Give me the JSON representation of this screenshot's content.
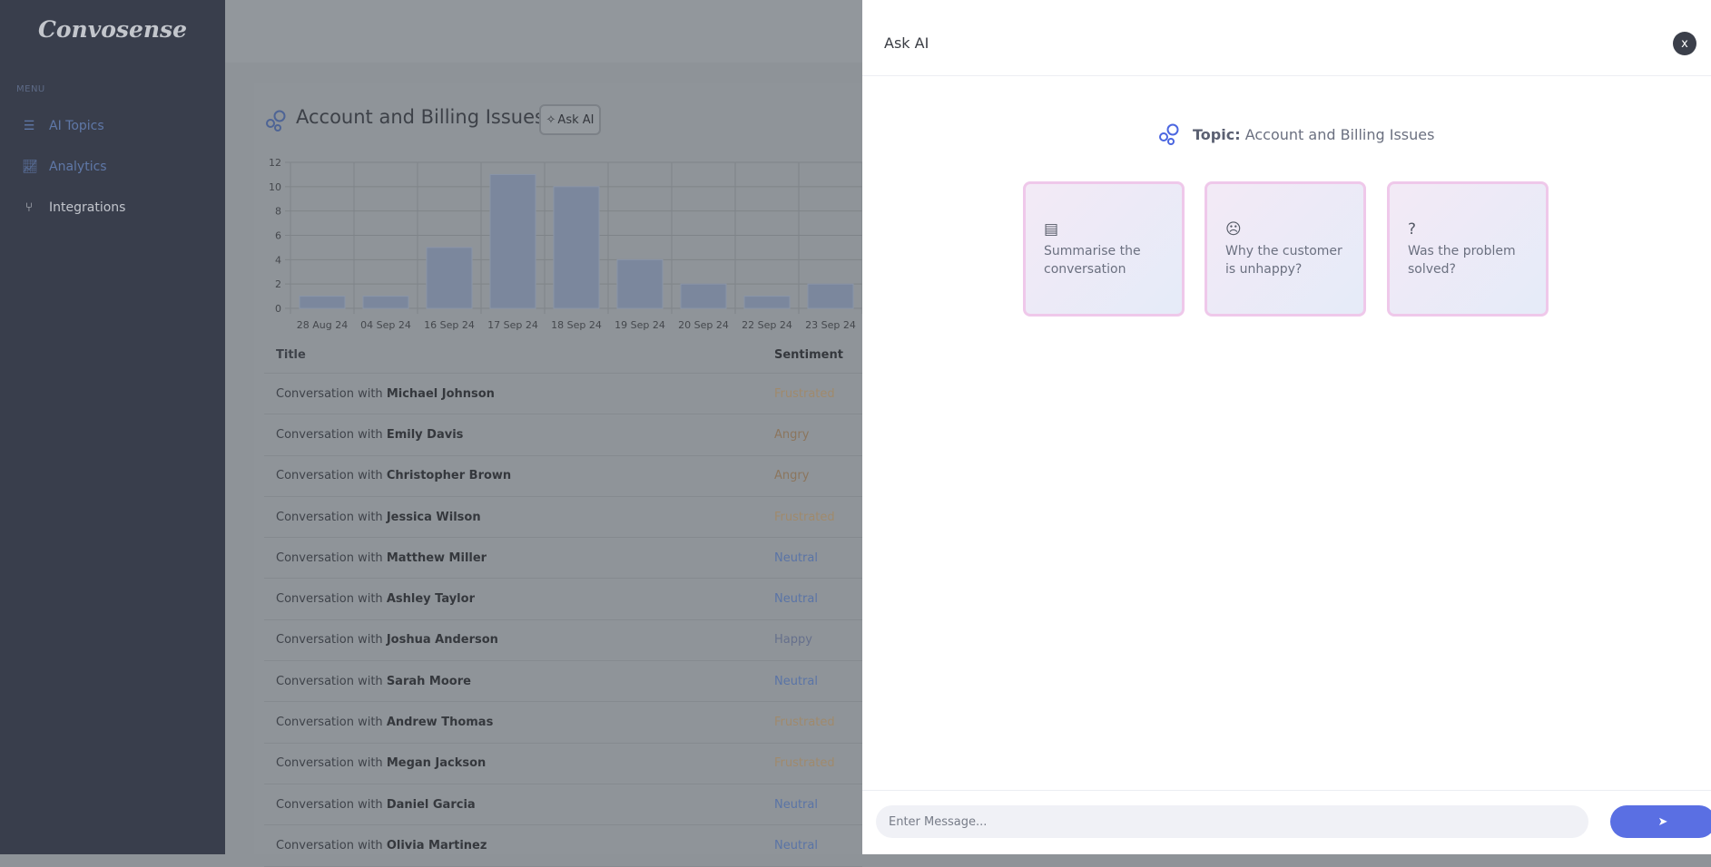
{
  "sidebar": {
    "logo": "Convosense",
    "menu_label": "MENU",
    "items": [
      {
        "label": "AI Topics",
        "icon": "list-icon"
      },
      {
        "label": "Analytics",
        "icon": "line-chart-icon"
      },
      {
        "label": "Integrations",
        "icon": "git-branch-icon"
      }
    ]
  },
  "main": {
    "topic_title": "Account and Billing Issues",
    "ask_ai_label": "Ask AI",
    "table": {
      "headers": [
        "Title",
        "Sentiment"
      ],
      "prefix": "Conversation with",
      "rows": [
        {
          "name": "Michael Johnson",
          "sentiment": "Frustrated"
        },
        {
          "name": "Emily Davis",
          "sentiment": "Angry"
        },
        {
          "name": "Christopher Brown",
          "sentiment": "Angry"
        },
        {
          "name": "Jessica Wilson",
          "sentiment": "Frustrated"
        },
        {
          "name": "Matthew Miller",
          "sentiment": "Neutral"
        },
        {
          "name": "Ashley Taylor",
          "sentiment": "Neutral"
        },
        {
          "name": "Joshua Anderson",
          "sentiment": "Happy"
        },
        {
          "name": "Sarah Moore",
          "sentiment": "Neutral"
        },
        {
          "name": "Andrew Thomas",
          "sentiment": "Frustrated"
        },
        {
          "name": "Megan Jackson",
          "sentiment": "Frustrated"
        },
        {
          "name": "Daniel Garcia",
          "sentiment": "Neutral"
        },
        {
          "name": "Olivia Martinez",
          "sentiment": "Neutral"
        }
      ]
    },
    "sentiment_colors": {
      "Frustrated": "#a08a6c",
      "Angry": "#8c765e",
      "Neutral": "#5a74a6",
      "Happy": "#66708c"
    }
  },
  "chart_data": {
    "type": "bar",
    "categories": [
      "28 Aug 24",
      "04 Sep 24",
      "16 Sep 24",
      "17 Sep 24",
      "18 Sep 24",
      "19 Sep 24",
      "20 Sep 24",
      "22 Sep 24",
      "23 Sep 24"
    ],
    "values": [
      1,
      1,
      5,
      11,
      10,
      4,
      2,
      1,
      2
    ],
    "yticks": [
      0,
      2,
      4,
      6,
      8,
      10,
      12
    ],
    "ylim": [
      0,
      12
    ],
    "grid": true,
    "bar_color": "#7b879d"
  },
  "panel": {
    "title": "Ask AI",
    "close_label": "x",
    "topic_label": "Topic:",
    "topic_value": "Account and Billing Issues",
    "suggestions": [
      {
        "icon": "document-icon",
        "glyph": "▤",
        "line1": "Summarise the",
        "line2": "conversation"
      },
      {
        "icon": "sad-face-icon",
        "glyph": "☹",
        "line1": "Why the customer",
        "line2": "is unhappy?"
      },
      {
        "icon": "question-icon",
        "glyph": "?",
        "line1": "Was the problem",
        "line2": "solved?"
      }
    ],
    "input_placeholder": "Enter Message...",
    "send_icon": "➤",
    "accent": "#5a6fe3"
  }
}
